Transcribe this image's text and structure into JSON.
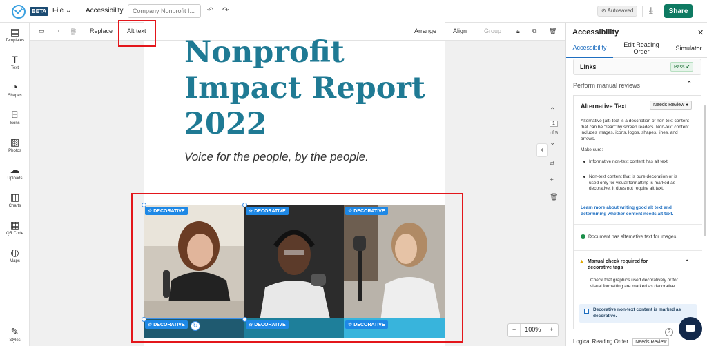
{
  "topbar": {
    "beta": "BETA",
    "file": "File",
    "accessibility": "Accessibility",
    "name_placeholder": "Company Nonprofit I...",
    "autosaved": "Autosaved",
    "share": "Share"
  },
  "left_tools": [
    {
      "label": "Templates",
      "icon": "templates-icon"
    },
    {
      "label": "Text",
      "icon": "text-icon"
    },
    {
      "label": "Shapes",
      "icon": "shapes-icon"
    },
    {
      "label": "Icons",
      "icon": "icons-icon"
    },
    {
      "label": "Photos",
      "icon": "photos-icon"
    },
    {
      "label": "Uploads",
      "icon": "uploads-icon"
    },
    {
      "label": "Charts",
      "icon": "charts-icon"
    },
    {
      "label": "QR Code",
      "icon": "qr-code-icon"
    },
    {
      "label": "Maps",
      "icon": "maps-icon"
    },
    {
      "label": "Styles",
      "icon": "styles-icon"
    }
  ],
  "context_toolbar": {
    "replace": "Replace",
    "alt_text": "Alt text",
    "arrange": "Arrange",
    "align": "Align",
    "group": "Group"
  },
  "page": {
    "title": "Nonprofit Impact Report 2022",
    "subtitle": "Voice for the people, by the people.",
    "decorative": "DECORATIVE"
  },
  "pager": {
    "current": "1",
    "of": "of 5"
  },
  "zoom": {
    "minus": "−",
    "level": "100%",
    "plus": "+"
  },
  "panel": {
    "title": "Accessibility",
    "tabs": [
      "Accessibility",
      "Edit Reading Order",
      "Simulator"
    ],
    "links_label": "Links",
    "links_status": "Pass",
    "manual_reviews": "Perform manual reviews",
    "alt_title": "Alternative Text",
    "alt_status": "Needs Review",
    "alt_desc": "Alternative (alt) text is a description of non-text content that can be \"read\" by screen readers. Non-text content includes images, icons, logos, shapes, lines, and arrows.",
    "make_sure": "Make sure:",
    "bullet1": "Informative non-text content has alt text",
    "bullet2": "Non-text content that is pure decoration or is used only for visual formatting is marked as decorative. It does not require alt text.",
    "learn_more": "Learn more about writing good alt text and determining whether content needs alt text.",
    "check_ok": "Document has alternative text for images.",
    "warn_title": "Manual check required for decorative tags",
    "warn_desc": "Check that graphics used decoratively or for visual formatting are marked as decorative.",
    "checkbox_label": "Decorative non-text content is marked as decorative.",
    "next_row": "Logical Reading Order",
    "next_status": "Needs Review"
  },
  "colors": {
    "accent": "#1f7a94",
    "share": "#0e7a62",
    "badge": "#1e88e5",
    "highlight": "#e3161b"
  }
}
